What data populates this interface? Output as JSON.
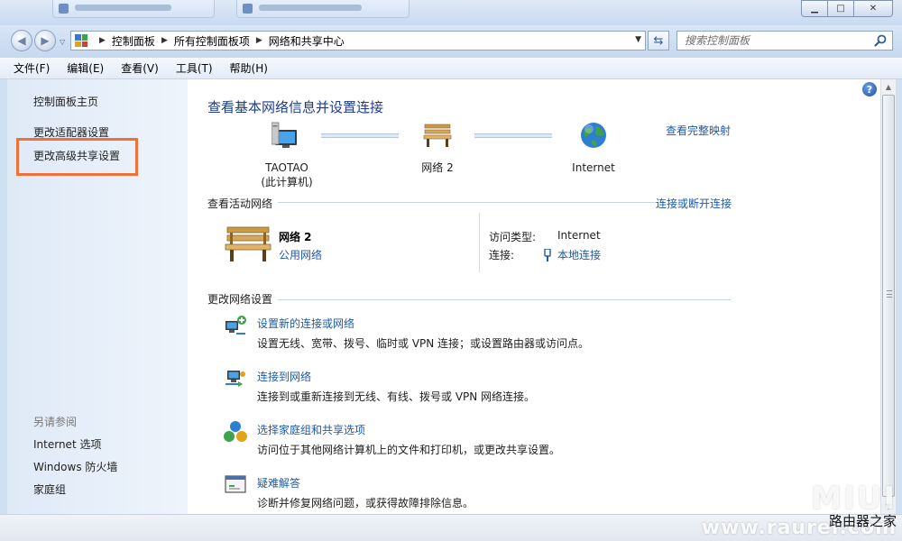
{
  "window": {
    "minimize_glyph": "▁",
    "maximize_glyph": "□",
    "close_glyph": "✕"
  },
  "address": {
    "breadcrumbs": [
      "控制面板",
      "所有控制面板项",
      "网络和共享中心"
    ],
    "search_placeholder": "搜索控制面板"
  },
  "menu": [
    "文件(F)",
    "编辑(E)",
    "查看(V)",
    "工具(T)",
    "帮助(H)"
  ],
  "sidebar": {
    "items": [
      "控制面板主页",
      "更改适配器设置",
      "更改高级共享设置"
    ],
    "see_also_label": "另请参阅",
    "see_also": [
      "Internet 选项",
      "Windows 防火墙",
      "家庭组"
    ]
  },
  "main": {
    "title": "查看基本网络信息并设置连接",
    "full_map_link": "查看完整映射",
    "map": {
      "computer_name": "TAOTAO",
      "computer_sub": "(此计算机)",
      "network": "网络  2",
      "internet": "Internet"
    },
    "active_section": {
      "label": "查看活动网络",
      "link": "连接或断开连接",
      "network_name": "网络  2",
      "network_type": "公用网络",
      "access_type_label": "访问类型:",
      "access_type_value": "Internet",
      "connection_label": "连接:",
      "connection_value": "本地连接"
    },
    "change_section": {
      "label": "更改网络设置",
      "tasks": [
        {
          "title": "设置新的连接或网络",
          "desc": "设置无线、宽带、拨号、临时或 VPN 连接；或设置路由器或访问点。",
          "icon": "new-connection-icon"
        },
        {
          "title": "连接到网络",
          "desc": "连接到或重新连接到无线、有线、拨号或 VPN 网络连接。",
          "icon": "connect-network-icon"
        },
        {
          "title": "选择家庭组和共享选项",
          "desc": "访问位于其他网络计算机上的文件和打印机，或更改共享设置。",
          "icon": "homegroup-icon"
        },
        {
          "title": "疑难解答",
          "desc": "诊断并修复网络问题，或获得故障排除信息。",
          "icon": "troubleshoot-icon"
        }
      ]
    }
  },
  "watermark": {
    "line1": "MIUI",
    "line2": "路由器之家",
    "line3": "www.raurer.com"
  },
  "colors": {
    "link": "#1e5aa8",
    "title": "#1e3c8c",
    "highlight": "#f0703a"
  }
}
